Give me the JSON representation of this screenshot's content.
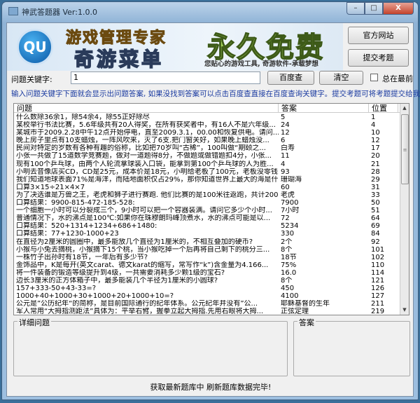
{
  "window": {
    "title": "神武答题器 Ver:1.0.0",
    "minimize": "–",
    "maximize": "□",
    "close": "X"
  },
  "banner": {
    "logo": "QU",
    "line1": "游戏管理专家",
    "line2": "奇游菜单",
    "slogan": "永久免费",
    "tagline": "您贴心的游戏工具, 奇游软件-承载梦想"
  },
  "buttons": {
    "official_site": "官方网站",
    "submit_question": "提交考题",
    "baidu_search": "百度查",
    "clear": "清空"
  },
  "search": {
    "label": "问题关键字:",
    "value": "1"
  },
  "always_on_top": {
    "label": "总在最前",
    "checked": false
  },
  "info_text": "输入问题关键字下面就会显示出问题答案, 如果没找到答案可以点击百度查直接在百度查询关键字。提交考题可将考题提交给我们",
  "table": {
    "columns": [
      "问题",
      "答案",
      "位置"
    ],
    "rows": [
      [
        "什么数除36余1，除54余4，除55正好除尽",
        "5",
        "1"
      ],
      [
        "某校举行书法比赛，5.6年级共有20人得奖，在所有获奖者中，有16人不是六年级...",
        "24",
        "4"
      ],
      [
        "某城市于2009.2.28中午12点开始停电，直至2009.3.1，00.00和恢复供电。请问...",
        "12",
        "10"
      ],
      [
        "晚上房子里点有10支蜡烛，一阵风吹来，灭了6支.把门窗关好，如果晚上蜡烛没...",
        "6",
        "12"
      ],
      [
        "民间对特定的岁数有各种有趣的俗称，比如把70岁叫“古稀”，100叫做“期颐之...",
        "白寿",
        "17"
      ],
      [
        "小张一共做了15道数学竞赛题，做对一道题得8分，不做题或做错题扣4分，小张...",
        "11",
        "20"
      ],
      [
        "现有100个乒乓球，由两个人轮流拿球装入口袋，能拿到第100个乒乓球的人为胜...",
        "4",
        "21"
      ],
      [
        "小明去音像店买CD，CD是25元，成本价是18元，小明给老板了100元，老板没零钱...",
        "93",
        "28"
      ],
      [
        "我们知道地球表面71%是海洋，而陆地面积仅占29%，那你知道世界上最大的海是什...",
        "珊瑚海",
        "29"
      ],
      [
        "口算3×15÷21×4×7",
        "60",
        "31"
      ],
      [
        "为了决选谁是万兽之王，老虎和狮子进行赛跑. 他们比赛的是100米往返跑，共计200...",
        "老虎",
        "33"
      ],
      [
        "口算结果：9900-815-472-185-528:",
        "7900",
        "50"
      ],
      [
        "一个细胞一小时可以分裂成三个，9小时可以把一个容器装满。请问它多少个小时...",
        "7小时",
        "51"
      ],
      [
        "普通情况下，水的沸点是100℃:如果你在珠穆朗玛峰顶煮水，水的沸点可能是以...",
        "72",
        "64"
      ],
      [
        "口算结果：520+1314+1234+686+1480:",
        "5234",
        "69"
      ],
      [
        "口算结果：77+1230-1000+23",
        "330",
        "84"
      ],
      [
        "在直径为2厘米的圆圈中，最多能放几个直径为1厘米的，不相互叠加的硬币?",
        "2个",
        "92"
      ],
      [
        "小猴与小兔去摘桃，小猴摘下15个桃，当小猴吃掉一个后再将自己剩下的桃分三...",
        "8个",
        "101"
      ],
      [
        "一株竹子出孙时有18节，一年后有多少节?",
        "18节",
        "102"
      ],
      [
        "金饰品中，K是每开(英文carat、德文karat的缩写，常写作“k”)含金量为4.166...",
        "75%",
        "110"
      ],
      [
        "将一件装备的锻造等级提升到4级，一共需要消耗多少颗1级的宝石?",
        "16.0",
        "114"
      ],
      [
        "边长3厘米的正方体箱子中，最多能装几个半径为1厘米的小圆球?",
        "8个",
        "121"
      ],
      [
        "157+333-50+43-33=?",
        "450",
        "126"
      ],
      [
        "1000+40+1000+30+1000+20+1000+10=?",
        "4100",
        "127"
      ],
      [
        "公元是”公历纪年“的简称，是目前国际通行的纪年体系。公元纪年并没有”公...",
        "耶稣基督的生年",
        "211"
      ],
      [
        "军人常用“大拇指测距法”具体为：平举右臂，握拳立起大拇指.先用右眼将大拇...",
        "正弦定理",
        "219"
      ]
    ]
  },
  "detail": {
    "question_label": "详细问题",
    "answer_label": "答案"
  },
  "status": "获取最新题库中   刷新题库数据完毕!"
}
